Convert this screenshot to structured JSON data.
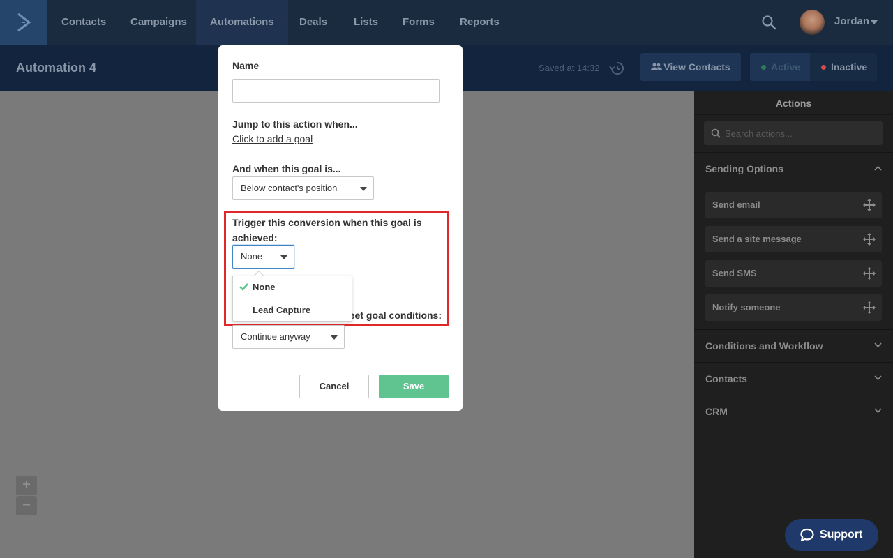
{
  "nav": {
    "logo_icon": "chevron-right-logo-icon",
    "items": [
      "Contacts",
      "Campaigns",
      "Automations",
      "Deals",
      "Lists",
      "Forms",
      "Reports"
    ],
    "active_item": "Automations",
    "user_name": "Jordan",
    "search_icon": "search-icon"
  },
  "subheader": {
    "title": "Automation 4",
    "saved_text": "Saved at 14:32",
    "history_icon": "history-icon",
    "view_contacts_label": "View Contacts",
    "active_label": "Active",
    "inactive_label": "Inactive",
    "active_dot_color": "#2f7a5a",
    "inactive_dot_color": "#d84a4a"
  },
  "panel": {
    "title": "Actions",
    "search_placeholder": "Search actions...",
    "sections": [
      {
        "label": "Sending Options",
        "expanded": true
      },
      {
        "label": "Conditions and Workflow",
        "expanded": false
      },
      {
        "label": "Contacts",
        "expanded": false
      },
      {
        "label": "CRM",
        "expanded": false
      }
    ],
    "sending_items": [
      "Send email",
      "Send a site message",
      "Send SMS",
      "Notify someone"
    ]
  },
  "zoom": {
    "in": "+",
    "out": "−"
  },
  "support": {
    "label": "Support"
  },
  "modal": {
    "name_label": "Name",
    "name_value": "",
    "jump_label": "Jump to this action when...",
    "add_goal_link": "Click to add a goal",
    "when_label": "And when this goal is...",
    "when_value": "Below contact's position",
    "trigger_label": "Trigger this conversion when this goal is achieved:",
    "trigger_value": "None",
    "trigger_options": [
      {
        "label": "None",
        "selected": true
      },
      {
        "label": "Lead Capture",
        "selected": false
      }
    ],
    "not_met_label_partial": "eet goal conditions:",
    "not_met_value": "Continue anyway",
    "cancel_label": "Cancel",
    "save_label": "Save",
    "save_color": "#5fc490",
    "highlight_color": "#e0282a"
  }
}
